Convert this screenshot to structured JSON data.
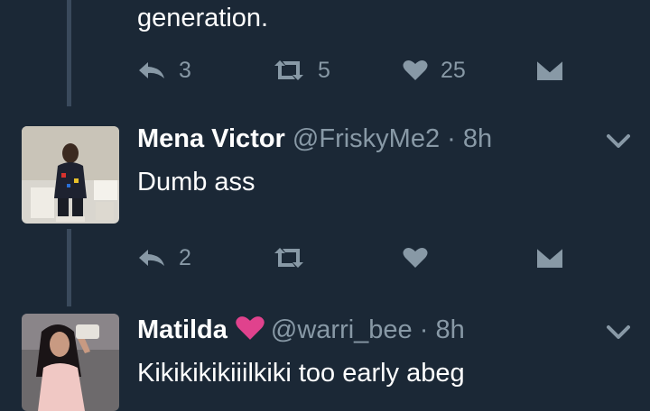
{
  "tweet0": {
    "text_tail": "generation.",
    "actions": {
      "reply": "3",
      "retweet": "5",
      "like": "25"
    }
  },
  "tweet1": {
    "name": "Mena Victor",
    "handle": "@FriskyMe2",
    "sep": " · ",
    "time": "8h",
    "text": "Dumb ass",
    "actions": {
      "reply": "2",
      "retweet": "",
      "like": ""
    }
  },
  "tweet2": {
    "name": "Matilda",
    "handle": "@warri_bee",
    "sep": " · ",
    "time": "8h",
    "text": "Kikikikikiiilkiki too early abeg"
  },
  "icons": {
    "reply": "reply-icon",
    "retweet": "retweet-icon",
    "like": "heart-icon",
    "dm": "envelope-icon",
    "menu": "chevron-down-icon",
    "badge": "pink-heart-icon"
  },
  "colors": {
    "background": "#1b2836",
    "icon": "#8899a6",
    "thread_line": "#3a4a5c",
    "badge": "#e0428d"
  }
}
